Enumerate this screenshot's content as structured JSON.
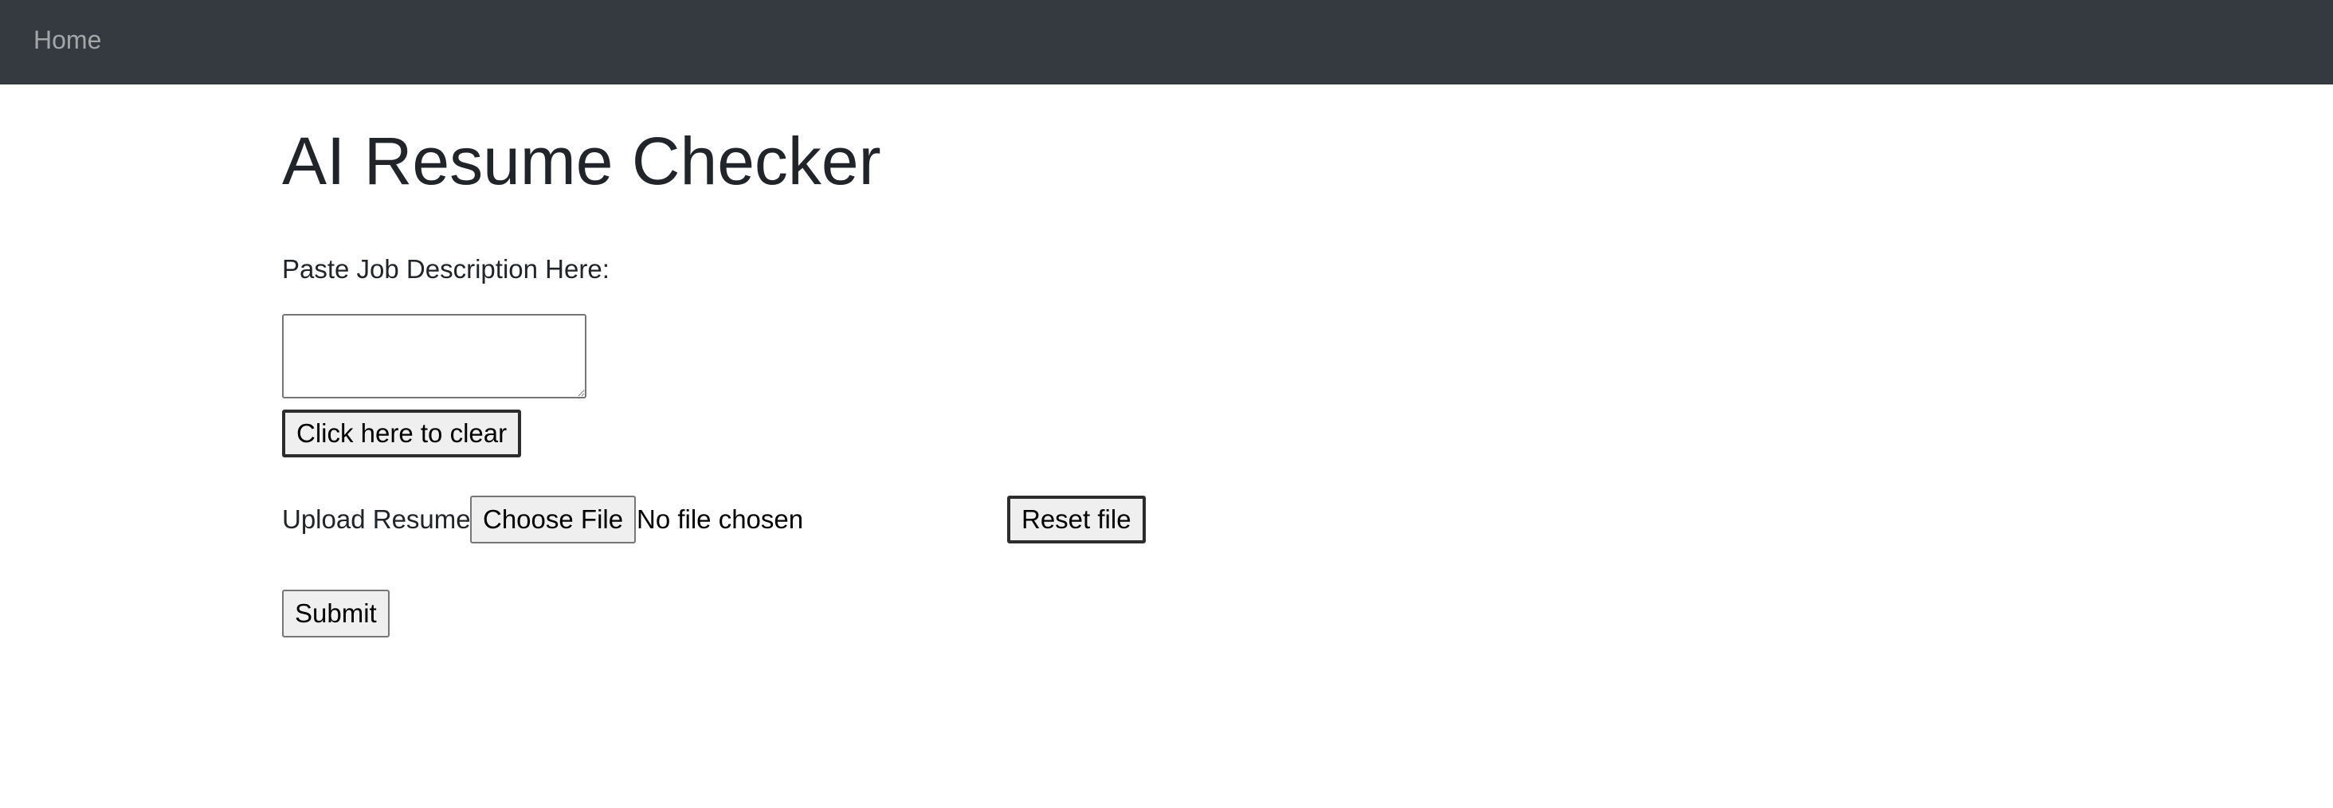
{
  "nav": {
    "home_label": "Home"
  },
  "main": {
    "title": "AI Resume Checker",
    "job_description": {
      "label": "Paste Job Description Here:",
      "value": "",
      "clear_button": "Click here to clear"
    },
    "resume": {
      "label": "Upload Resume",
      "choose_button": "Choose File",
      "file_status": "No file chosen",
      "reset_button": "Reset file"
    },
    "submit_button": "Submit"
  },
  "colors": {
    "navbar_bg": "#343a40",
    "nav_link": "#9a9da0",
    "text": "#212529",
    "button_bg": "#efefef"
  }
}
